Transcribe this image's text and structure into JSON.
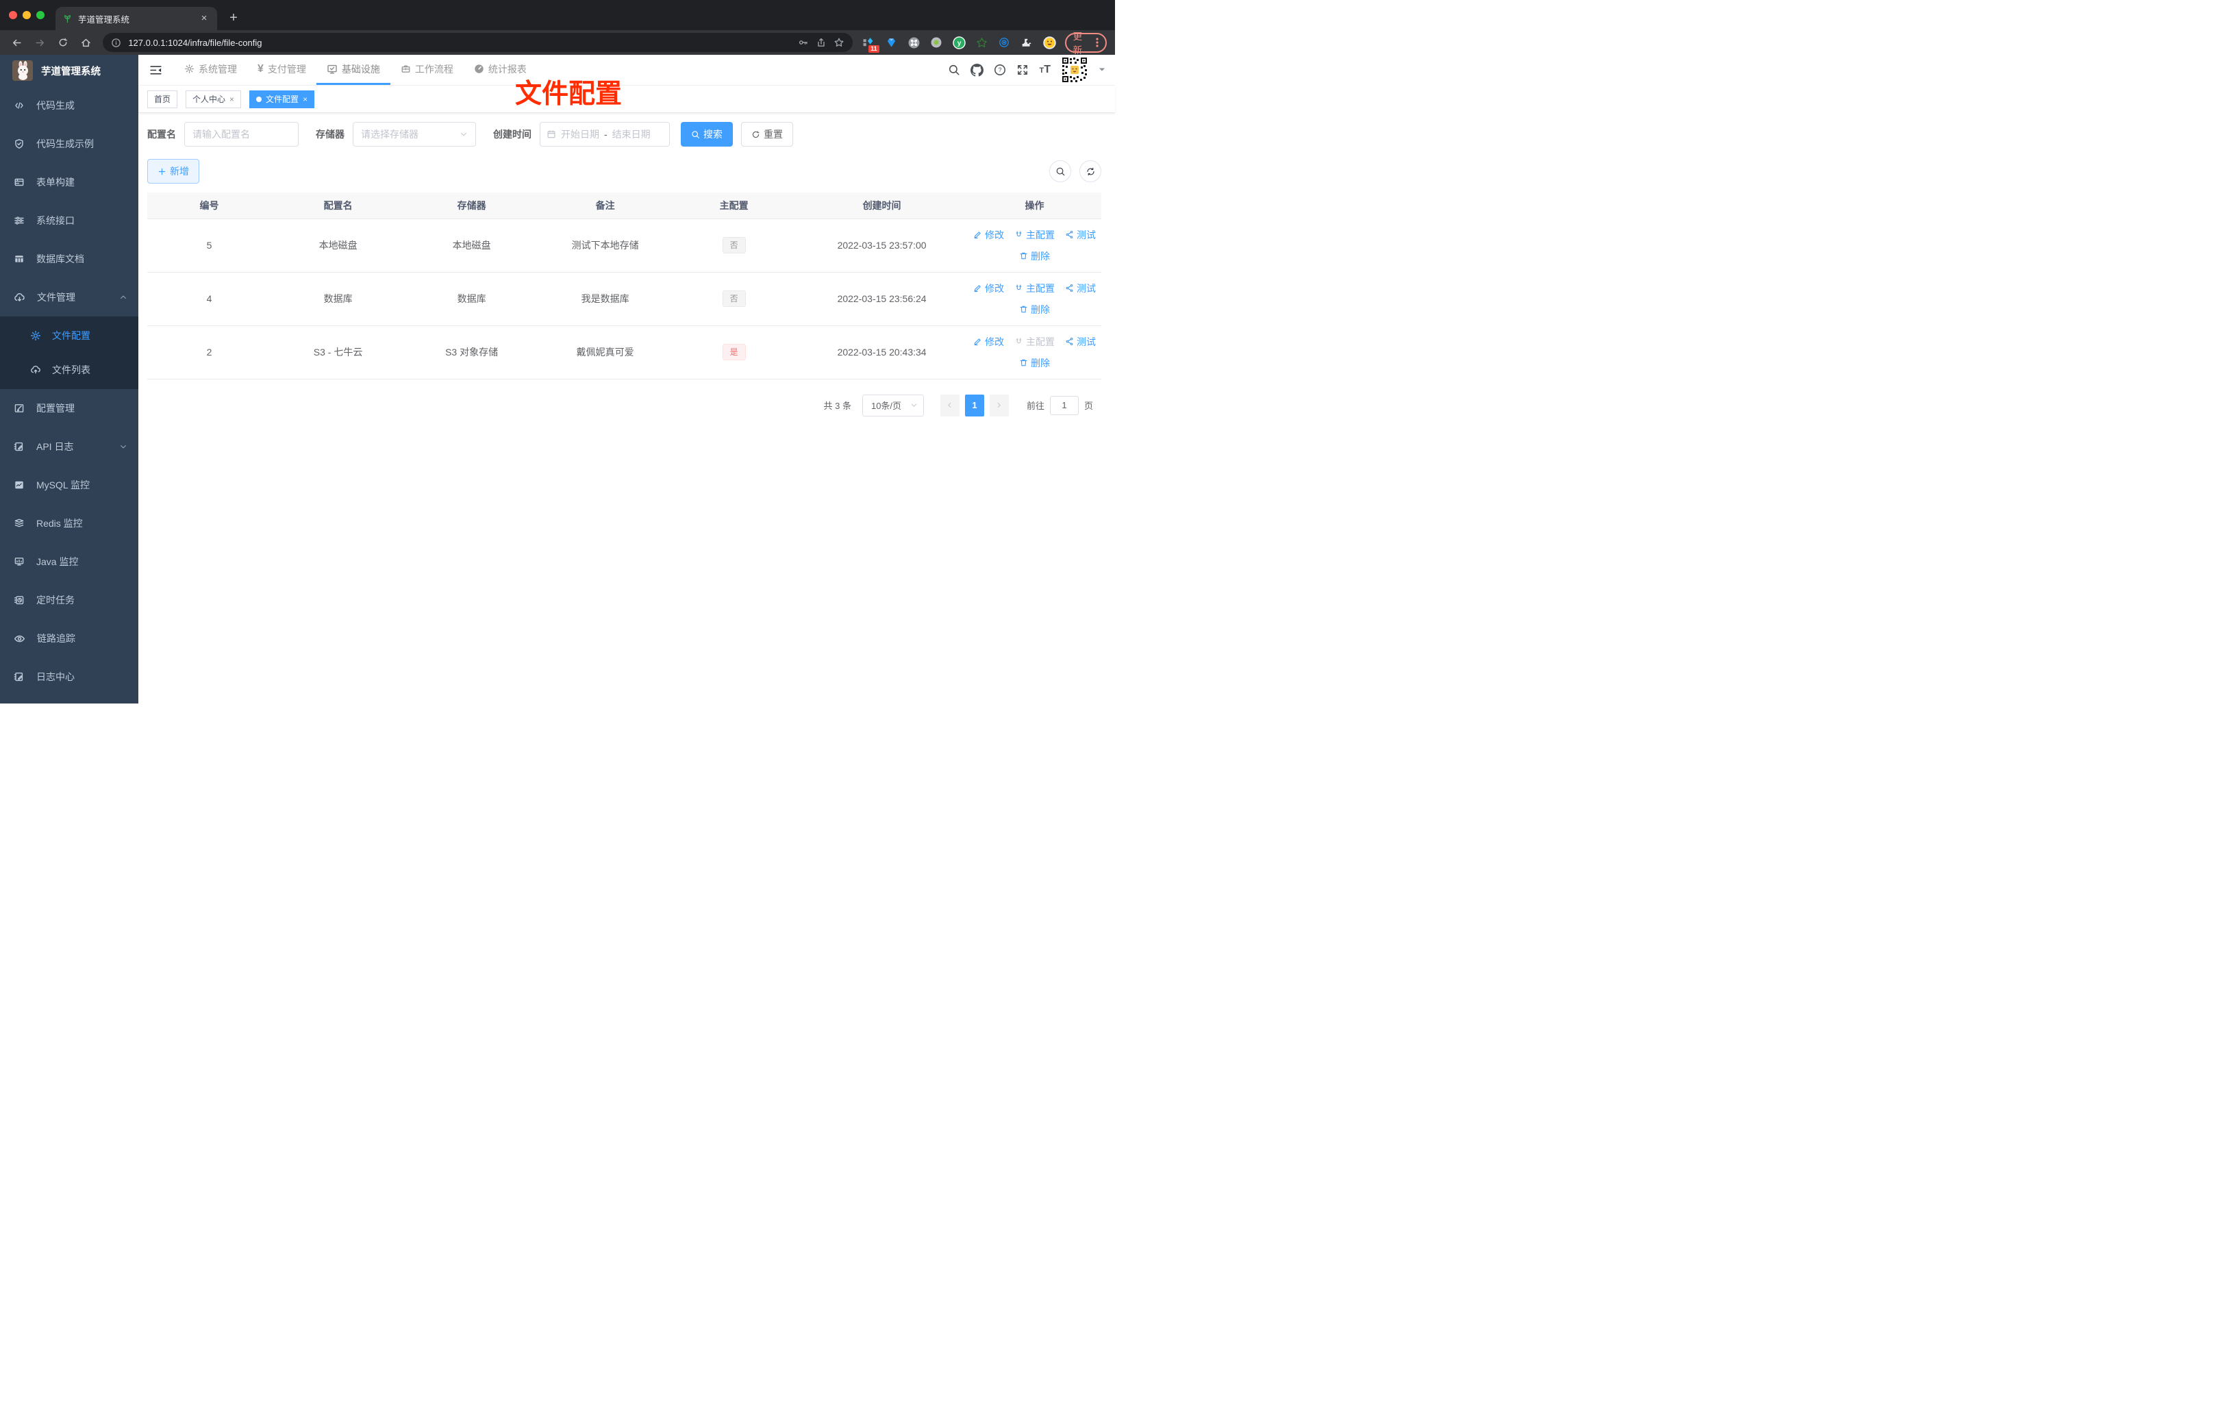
{
  "browser": {
    "tab_title": "芋道管理系统",
    "url": "127.0.0.1:1024/infra/file/file-config",
    "extension_badge": "11",
    "update_label": "更新"
  },
  "sidebar": {
    "title": "芋道管理系统",
    "items": [
      "代码生成",
      "代码生成示例",
      "表单构建",
      "系统接口",
      "数据库文档",
      "文件管理",
      "配置管理",
      "API 日志",
      "MySQL 监控",
      "Redis 监控",
      "Java 监控",
      "定时任务",
      "链路追踪",
      "日志中心"
    ],
    "submenu": [
      "文件配置",
      "文件列表"
    ]
  },
  "topnav": {
    "items": [
      "系统管理",
      "支付管理",
      "基础设施",
      "工作流程",
      "统计报表"
    ]
  },
  "tags": [
    "首页",
    "个人中心",
    "文件配置"
  ],
  "annotation": {
    "text": "文件配置"
  },
  "filters": {
    "name_label": "配置名",
    "name_placeholder": "请输入配置名",
    "storage_label": "存储器",
    "storage_placeholder": "请选择存储器",
    "date_label": "创建时间",
    "date_start_placeholder": "开始日期",
    "date_separator": "-",
    "date_end_placeholder": "结束日期",
    "search_button": "搜索",
    "reset_button": "重置",
    "add_button": "新增"
  },
  "table": {
    "columns": [
      "编号",
      "配置名",
      "存储器",
      "备注",
      "主配置",
      "创建时间",
      "操作"
    ],
    "actions": {
      "edit": "修改",
      "master": "主配置",
      "test": "测试",
      "delete": "删除"
    },
    "rows": [
      {
        "id": "5",
        "name": "本地磁盘",
        "storage": "本地磁盘",
        "remark": "测试下本地存储",
        "primary": "否",
        "created": "2022-03-15 23:57:00"
      },
      {
        "id": "4",
        "name": "数据库",
        "storage": "数据库",
        "remark": "我是数据库",
        "primary": "否",
        "created": "2022-03-15 23:56:24"
      },
      {
        "id": "2",
        "name": "S3 - 七牛云",
        "storage": "S3 对象存储",
        "remark": "戴佩妮真可爱",
        "primary": "是",
        "created": "2022-03-15 20:43:34"
      }
    ]
  },
  "pagination": {
    "total": "共 3 条",
    "page_size": "10条/页",
    "current_page": "1",
    "goto_label": "前往",
    "goto_value": "1",
    "page_unit": "页"
  },
  "colors": {
    "accent": "#409eff",
    "danger": "#f56c6c",
    "sidebar_bg": "#304156",
    "annotation": "#ff2d00"
  }
}
